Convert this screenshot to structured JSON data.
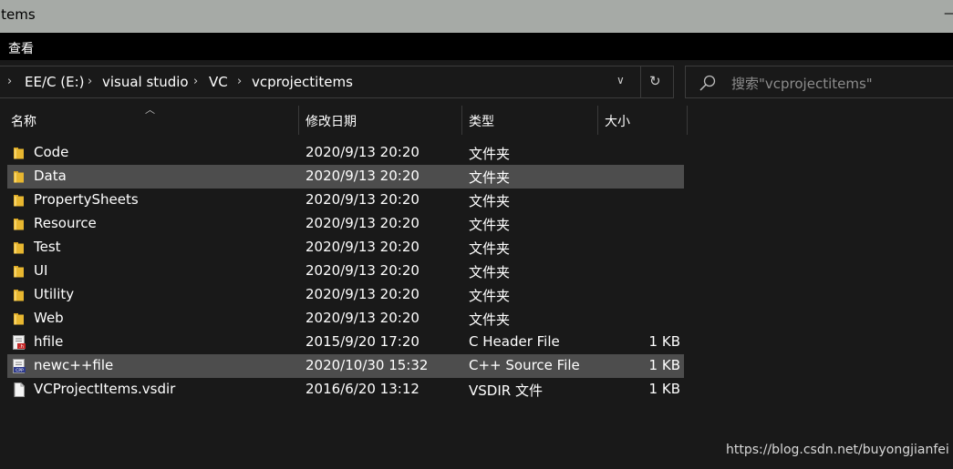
{
  "window": {
    "title": "items"
  },
  "ribbon": {
    "view_label": "查看"
  },
  "address": {
    "crumbs": [
      "EE/C (E:)",
      "visual studio",
      "VC",
      "vcprojectitems"
    ]
  },
  "search": {
    "placeholder": "搜索\"vcprojectitems\""
  },
  "columns": {
    "name": "名称",
    "date": "修改日期",
    "type": "类型",
    "size": "大小"
  },
  "files": [
    {
      "name": "Code",
      "date": "2020/9/13 20:20",
      "type": "文件夹",
      "size": "",
      "icon": "folder-icon",
      "selected": false
    },
    {
      "name": "Data",
      "date": "2020/9/13 20:20",
      "type": "文件夹",
      "size": "",
      "icon": "folder-icon",
      "selected": true
    },
    {
      "name": "PropertySheets",
      "date": "2020/9/13 20:20",
      "type": "文件夹",
      "size": "",
      "icon": "folder-icon",
      "selected": false
    },
    {
      "name": "Resource",
      "date": "2020/9/13 20:20",
      "type": "文件夹",
      "size": "",
      "icon": "folder-icon",
      "selected": false
    },
    {
      "name": "Test",
      "date": "2020/9/13 20:20",
      "type": "文件夹",
      "size": "",
      "icon": "folder-icon",
      "selected": false
    },
    {
      "name": "UI",
      "date": "2020/9/13 20:20",
      "type": "文件夹",
      "size": "",
      "icon": "folder-icon",
      "selected": false
    },
    {
      "name": "Utility",
      "date": "2020/9/13 20:20",
      "type": "文件夹",
      "size": "",
      "icon": "folder-icon",
      "selected": false
    },
    {
      "name": "Web",
      "date": "2020/9/13 20:20",
      "type": "文件夹",
      "size": "",
      "icon": "folder-icon",
      "selected": false
    },
    {
      "name": "hfile",
      "date": "2015/9/20 17:20",
      "type": "C Header File",
      "size": "1 KB",
      "icon": "c-header-file-icon",
      "selected": false
    },
    {
      "name": "newc++file",
      "date": "2020/10/30 15:32",
      "type": "C++ Source File",
      "size": "1 KB",
      "icon": "cpp-source-file-icon",
      "selected": true
    },
    {
      "name": "VCProjectItems.vsdir",
      "date": "2016/6/20 13:12",
      "type": "VSDIR 文件",
      "size": "1 KB",
      "icon": "generic-file-icon",
      "selected": false
    }
  ],
  "watermark": "https://blog.csdn.net/buyongjianfei",
  "colors": {
    "background": "#191919",
    "selection": "#4d4d4d",
    "folder": "#e8b730",
    "titlebar": "#a6aaa6"
  }
}
